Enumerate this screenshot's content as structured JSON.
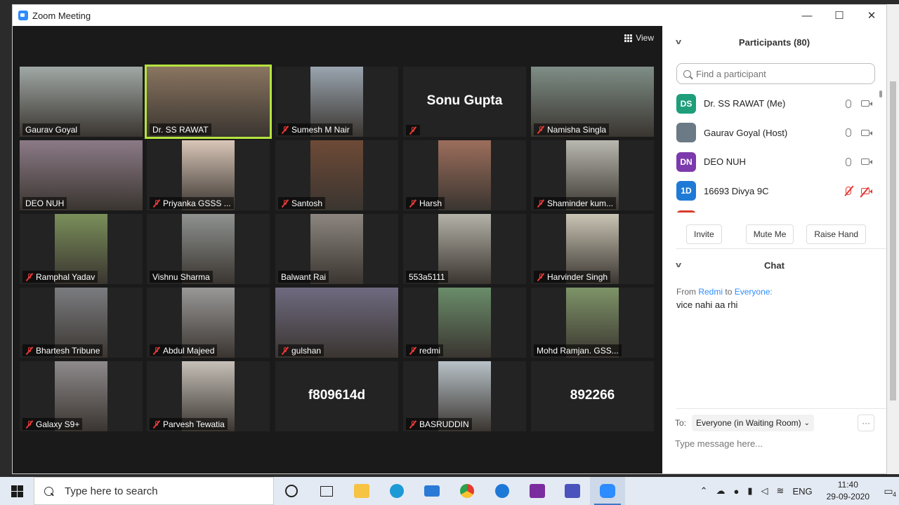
{
  "window": {
    "title": "Zoom Meeting",
    "minimize": "—",
    "maximize": "☐",
    "close": "✕"
  },
  "video": {
    "view_label": "View",
    "tiles": [
      {
        "name": "Gaurav Goyal",
        "muted": false,
        "video": "#a0a8a5"
      },
      {
        "name": "Dr. SS RAWAT",
        "muted": false,
        "video": "#8a7560",
        "speaking": true
      },
      {
        "name": "Sumesh M Nair",
        "muted": true,
        "video": "#9aa5b0",
        "narrow": true
      },
      {
        "name": "Sonu Gupta",
        "muted": true,
        "big": true
      },
      {
        "name": "Namisha Singla",
        "muted": true,
        "video": "#7e8e86"
      },
      {
        "name": "DEO NUH",
        "muted": false,
        "video": "#8b7a86"
      },
      {
        "name": "Priyanka GSSS ...",
        "muted": true,
        "video": "#d9c6b8",
        "narrow": true
      },
      {
        "name": "Santosh",
        "muted": true,
        "video": "#6e4a36",
        "narrow": true
      },
      {
        "name": "Harsh",
        "muted": true,
        "video": "#9c6e5c",
        "narrow": true
      },
      {
        "name": "Shaminder kum...",
        "muted": true,
        "video": "#b9b8b0",
        "narrow": true
      },
      {
        "name": "Ramphal Yadav",
        "muted": true,
        "video": "#7a8f5a",
        "narrow": true
      },
      {
        "name": "Vishnu Sharma",
        "muted": false,
        "video": "#8f9290",
        "narrow": true
      },
      {
        "name": "Balwant Rai",
        "muted": false,
        "video": "#8d8680",
        "narrow": true
      },
      {
        "name": "553a5111",
        "muted": false,
        "video": "#b4b2a8",
        "narrow": true
      },
      {
        "name": "Harvinder Singh",
        "muted": true,
        "video": "#c9c4b4",
        "narrow": true
      },
      {
        "name": "Bhartesh Tribune",
        "muted": true,
        "video": "#7b7c80",
        "narrow": true
      },
      {
        "name": "Abdul Majeed",
        "muted": true,
        "video": "#9a9998",
        "narrow": true
      },
      {
        "name": "gulshan",
        "muted": true,
        "video": "#6f6a80"
      },
      {
        "name": "redmi",
        "muted": true,
        "video": "#6a8d6a",
        "narrow": true
      },
      {
        "name": "Mohd Ramjan. GSS...",
        "muted": false,
        "video": "#7e9468",
        "narrow": true
      },
      {
        "name": "Galaxy S9+",
        "muted": true,
        "video": "#8e8a8c",
        "narrow": true
      },
      {
        "name": "Parvesh Tewatia",
        "muted": true,
        "video": "#c6c0b8",
        "narrow": true
      },
      {
        "name": "f809614d",
        "muted": false,
        "big": true
      },
      {
        "name": "BASRUDDIN",
        "muted": true,
        "video": "#b8c2c8",
        "narrow": true
      },
      {
        "name": "892266",
        "muted": false,
        "big": true
      }
    ]
  },
  "participants": {
    "header": "Participants (80)",
    "search_placeholder": "Find a participant",
    "list": [
      {
        "initials": "DS",
        "name": "Dr. SS RAWAT (Me)",
        "color": "#1e9e7a",
        "muted": false
      },
      {
        "initials": "",
        "name": "Gaurav Goyal (Host)",
        "color": "#6b7a84",
        "muted": false
      },
      {
        "initials": "DN",
        "name": "DEO NUH",
        "color": "#7c3aad",
        "muted": false
      },
      {
        "initials": "1D",
        "name": "16693 Divya 9C",
        "color": "#1f7ad6",
        "muted": true
      },
      {
        "initials": "",
        "name": "",
        "color": "#d93a2b",
        "muted": true
      }
    ],
    "invite": "Invite",
    "mute_me": "Mute Me",
    "raise_hand": "Raise Hand"
  },
  "chat": {
    "header": "Chat",
    "from_prefix": "From",
    "from": "Redmi",
    "to_word": "to",
    "to": "Everyone:",
    "message": "vice nahi aa rhi",
    "to_label": "To:",
    "to_select": "Everyone (in Waiting Room)",
    "more": "···",
    "input_placeholder": "Type message here..."
  },
  "taskbar": {
    "search_placeholder": "Type here to search",
    "lang": "ENG",
    "time": "11:40",
    "date": "29-09-2020",
    "notif_count": "4"
  }
}
